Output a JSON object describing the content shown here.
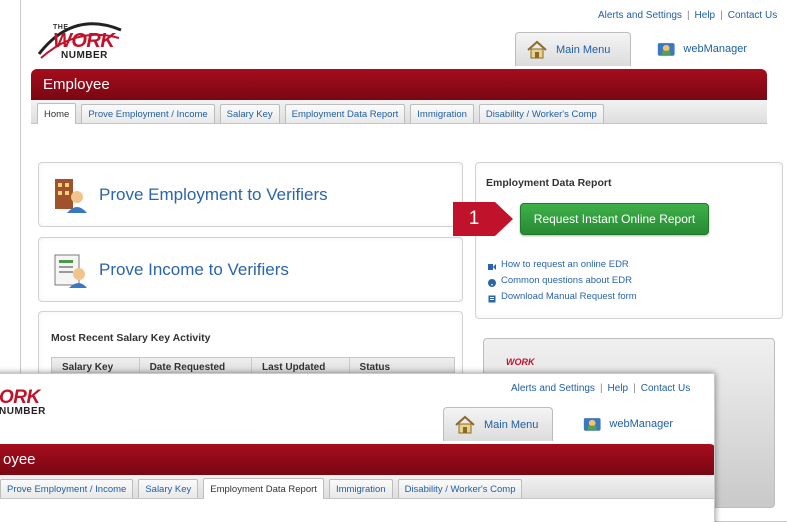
{
  "top_links": {
    "alerts": "Alerts and Settings",
    "sep": "|",
    "help": "Help",
    "contact": "Contact Us"
  },
  "logo": {
    "the": "THE",
    "work": "WORK",
    "number": "NUMBER"
  },
  "header_tabs": {
    "main_menu": "Main Menu",
    "webmanager": "webManager"
  },
  "section_title": "Employee",
  "tabs": [
    "Home",
    "Prove Employment / Income",
    "Salary Key",
    "Employment Data Report",
    "Immigration",
    "Disability / Worker's Comp"
  ],
  "cards": {
    "prove_employment": "Prove Employment to Verifiers",
    "prove_income": "Prove Income to Verifiers"
  },
  "edr_panel": {
    "title": "Employment Data Report",
    "button": "Request Instant Online Report",
    "links": [
      "How to request an online EDR",
      "Common questions about EDR",
      "Download Manual Request form"
    ]
  },
  "salary_activity": {
    "title": "Most Recent Salary Key Activity",
    "columns": [
      "Salary Key",
      "Date Requested",
      "Last Updated",
      "Status"
    ]
  },
  "callout_number": "1",
  "front": {
    "logo_partial": "ORK",
    "number_partial": "NUMBER",
    "section_partial": "oyee",
    "tabs": [
      "Prove Employment / Income",
      "Salary Key",
      "Employment Data Report",
      "Immigration",
      "Disability / Worker's Comp"
    ]
  },
  "colors": {
    "brand_red": "#a50d1c",
    "link_blue": "#2a64ad",
    "button_green": "#2f9a3b"
  },
  "icons": [
    "home-icon",
    "webmanager-icon",
    "building-person-icon",
    "income-document-icon"
  ]
}
